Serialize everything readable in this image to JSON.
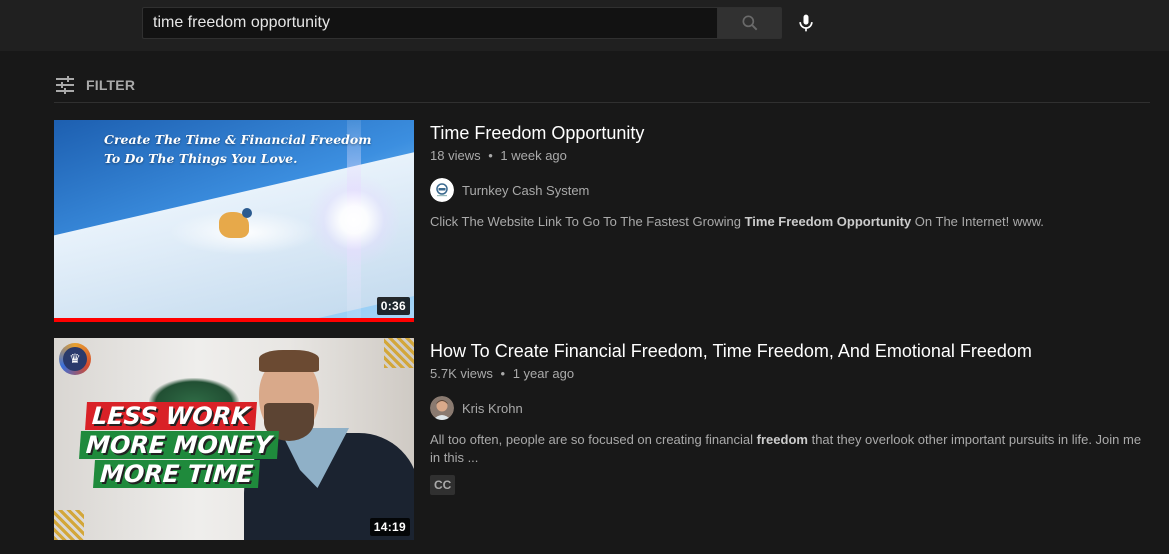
{
  "header": {
    "search_query": "time freedom opportunity",
    "search_button_icon": "search-icon",
    "voice_button_icon": "microphone-icon"
  },
  "filter": {
    "label": "FILTER",
    "icon": "sliders-icon"
  },
  "results": [
    {
      "title": "Time Freedom Opportunity",
      "views": "18 views",
      "separator": "•",
      "age": "1 week ago",
      "channel": "Turnkey Cash System",
      "description_parts": [
        {
          "text": "Click The Website Link To Go To The Fastest Growing ",
          "bold": false
        },
        {
          "text": "Time Freedom Opportunity",
          "bold": true
        },
        {
          "text": " On The Internet! www.",
          "bold": false
        }
      ],
      "duration": "0:36",
      "watch_progress": 1.0,
      "thumbnail_text": [
        "Create The Time & Financial Freedom",
        "To Do The Things You Love."
      ],
      "badges": []
    },
    {
      "title": "How To Create Financial Freedom, Time Freedom, And Emotional Freedom",
      "views": "5.7K views",
      "separator": "•",
      "age": "1 year ago",
      "channel": "Kris Krohn",
      "description_parts": [
        {
          "text": "All too often, people are so focused on creating financial ",
          "bold": false
        },
        {
          "text": "freedom",
          "bold": true
        },
        {
          "text": " that they overlook other important pursuits in life. Join me in this ...",
          "bold": false
        }
      ],
      "duration": "14:19",
      "watch_progress": null,
      "thumbnail_text": [
        "LESS WORK",
        "MORE MONEY",
        "MORE TIME"
      ],
      "badges": [
        "CC"
      ]
    }
  ],
  "colors": {
    "background": "#181818",
    "header": "#202020",
    "progress": "#ff0000",
    "secondary_text": "#aaaaaa"
  }
}
